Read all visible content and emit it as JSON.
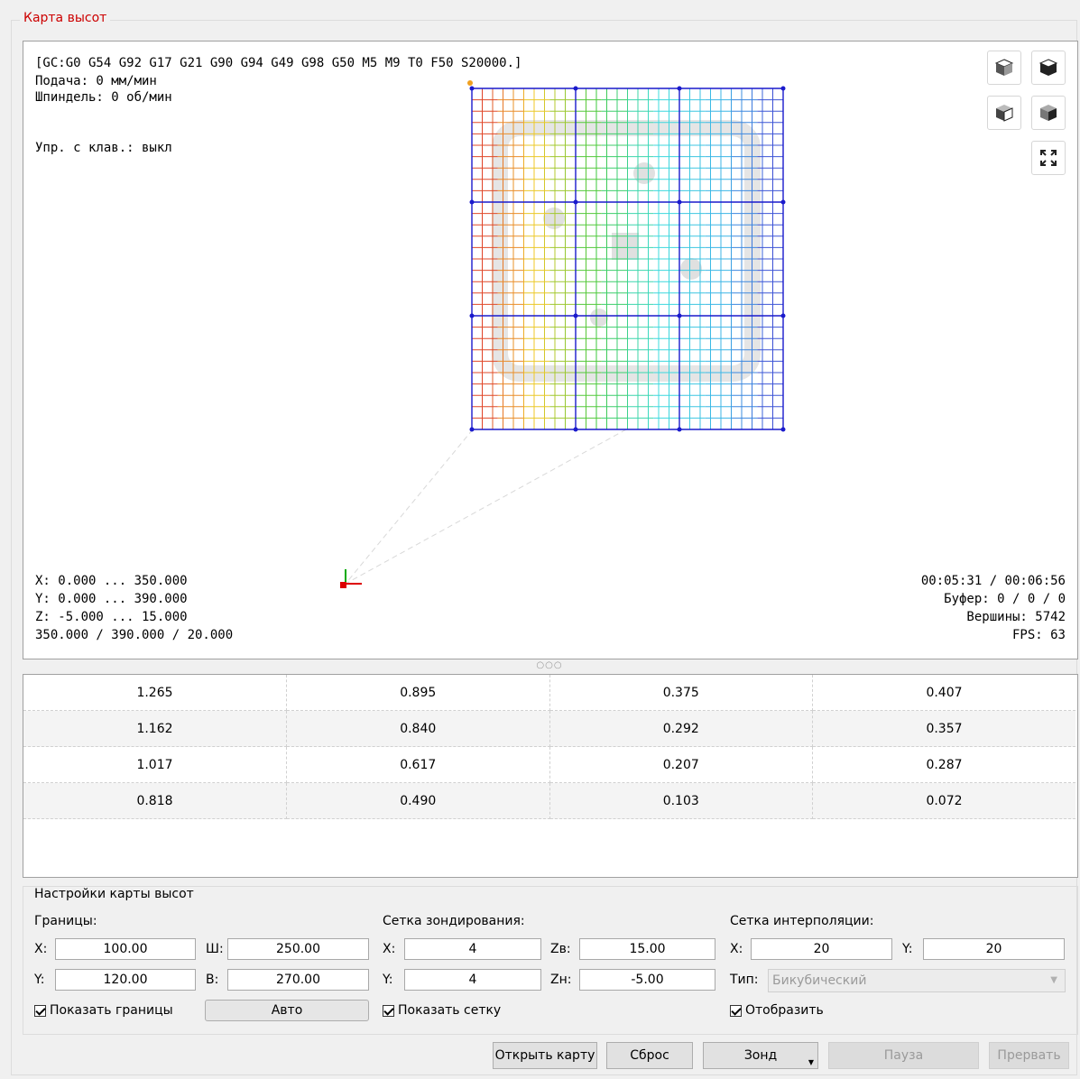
{
  "group_title": "Карта высот",
  "viewport": {
    "gcode_state": "[GC:G0 G54 G92 G17 G21 G90 G94 G49 G98 G50 M5 M9 T0 F50 S20000.]",
    "feed": "Подача: 0 мм/мин",
    "spindle": "Шпиндель: 0 об/мин",
    "keyboard_control": "Упр. с клав.: выкл",
    "x_range": "X: 0.000 ... 350.000",
    "y_range": "Y: 0.000 ... 390.000",
    "z_range": "Z: -5.000 ... 15.000",
    "dimensions": "350.000 / 390.000 / 20.000",
    "time": "00:05:31 / 00:06:56",
    "buffer": "Буфер: 0 / 0 / 0",
    "vertices": "Вершины: 5742",
    "fps": "FPS: 63",
    "icons": [
      "cube-front-icon",
      "cube-top-icon",
      "cube-left-icon",
      "cube-isometric-icon",
      "fit-view-icon"
    ]
  },
  "splitter": "○○○",
  "height_table": {
    "rows": [
      [
        "1.265",
        "0.895",
        "0.375",
        "0.407"
      ],
      [
        "1.162",
        "0.840",
        "0.292",
        "0.357"
      ],
      [
        "1.017",
        "0.617",
        "0.207",
        "0.287"
      ],
      [
        "0.818",
        "0.490",
        "0.103",
        "0.072"
      ]
    ]
  },
  "settings": {
    "title": "Настройки карты высот",
    "bounds": {
      "title": "Границы:",
      "x_label": "X:",
      "x_value": "100.00",
      "w_label": "Ш:",
      "w_value": "250.00",
      "y_label": "Y:",
      "y_value": "120.00",
      "h_label": "В:",
      "h_value": "270.00",
      "show_bounds": "Показать границы",
      "auto_button": "Авто"
    },
    "probe_grid": {
      "title": "Сетка зондирования:",
      "x_label": "X:",
      "x_value": "4",
      "zt_label": "Zв:",
      "zt_value": "15.00",
      "y_label": "Y:",
      "y_value": "4",
      "zb_label": "Zн:",
      "zb_value": "-5.00",
      "show_grid": "Показать сетку"
    },
    "interp_grid": {
      "title": "Сетка интерполяции:",
      "x_label": "X:",
      "x_value": "20",
      "y_label": "Y:",
      "y_value": "20",
      "type_label": "Тип:",
      "type_value": "Бикубический",
      "display": "Отобразить"
    }
  },
  "buttons": {
    "open_map": "Открыть карту",
    "reset": "Сброс",
    "probe": "Зонд",
    "pause": "Пауза",
    "abort": "Прервать"
  }
}
